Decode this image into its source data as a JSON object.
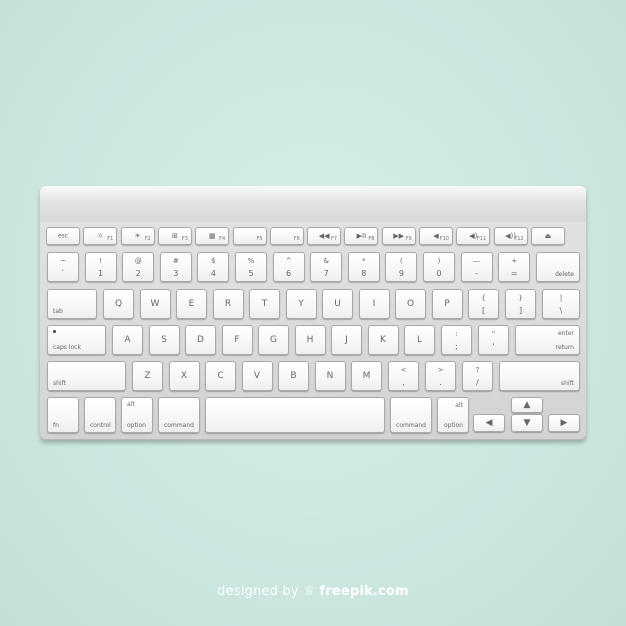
{
  "keyboard": {
    "function_row": [
      {
        "name": "esc",
        "main": "esc"
      },
      {
        "name": "f1",
        "icon": "☼",
        "num": "F1"
      },
      {
        "name": "f2",
        "icon": "☀",
        "num": "F2"
      },
      {
        "name": "f3",
        "icon": "⊞",
        "num": "F3"
      },
      {
        "name": "f4",
        "icon": "▦",
        "num": "F4"
      },
      {
        "name": "f5",
        "icon": "",
        "num": "F5"
      },
      {
        "name": "f6",
        "icon": "",
        "num": "F6"
      },
      {
        "name": "f7",
        "icon": "◀◀",
        "num": "F7"
      },
      {
        "name": "f8",
        "icon": "▶II",
        "num": "F8"
      },
      {
        "name": "f9",
        "icon": "▶▶",
        "num": "F9"
      },
      {
        "name": "f10",
        "icon": "◀",
        "num": "F10"
      },
      {
        "name": "f11",
        "icon": "◀)",
        "num": "F11"
      },
      {
        "name": "f12",
        "icon": "◀))",
        "num": "F12"
      },
      {
        "name": "eject",
        "icon": "⏏",
        "num": ""
      }
    ],
    "number_row": [
      {
        "name": "backtick",
        "top": "~",
        "bot": "`"
      },
      {
        "name": "1",
        "top": "!",
        "bot": "1"
      },
      {
        "name": "2",
        "top": "@",
        "bot": "2"
      },
      {
        "name": "3",
        "top": "#",
        "bot": "3"
      },
      {
        "name": "4",
        "top": "$",
        "bot": "4"
      },
      {
        "name": "5",
        "top": "%",
        "bot": "5"
      },
      {
        "name": "6",
        "top": "^",
        "bot": "6"
      },
      {
        "name": "7",
        "top": "&",
        "bot": "7"
      },
      {
        "name": "8",
        "top": "*",
        "bot": "8"
      },
      {
        "name": "9",
        "top": "(",
        "bot": "9"
      },
      {
        "name": "0",
        "top": ")",
        "bot": "0"
      },
      {
        "name": "minus",
        "top": "—",
        "bot": "-"
      },
      {
        "name": "equals",
        "top": "+",
        "bot": "="
      }
    ],
    "delete_label": "delete",
    "tab_label": "tab",
    "qwerty_row": [
      "Q",
      "W",
      "E",
      "R",
      "T",
      "Y",
      "U",
      "I",
      "O",
      "P"
    ],
    "bracket_left": {
      "top": "{",
      "bot": "["
    },
    "bracket_right": {
      "top": "}",
      "bot": "]"
    },
    "backslash": {
      "top": "|",
      "bot": "\\"
    },
    "caps_label": "caps lock",
    "home_row": [
      "A",
      "S",
      "D",
      "F",
      "G",
      "H",
      "J",
      "K",
      "L"
    ],
    "semicolon": {
      "top": ":",
      "bot": ";"
    },
    "quote": {
      "top": "\"",
      "bot": "'"
    },
    "enter_label": "enter",
    "return_label": "return",
    "shift_label": "shift",
    "bottom_row": [
      "Z",
      "X",
      "C",
      "V",
      "B",
      "N",
      "M"
    ],
    "comma": {
      "top": "<",
      "bot": ","
    },
    "period": {
      "top": ">",
      "bot": "."
    },
    "slash": {
      "top": "?",
      "bot": "/"
    },
    "fn_label": "fn",
    "control_label": "control",
    "option_label": "option",
    "option_alt": "alt",
    "command_label": "command",
    "arrows": {
      "left": "◀",
      "right": "▶",
      "up": "▲",
      "down": "▼"
    }
  },
  "credit": {
    "prefix": "designed by",
    "icon": "♕",
    "brand": "freepik.com"
  }
}
